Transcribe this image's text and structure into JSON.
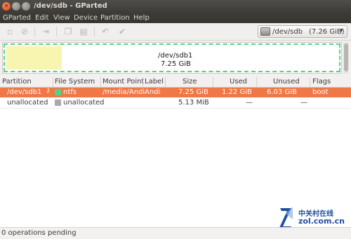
{
  "window": {
    "title": "/dev/sdb - GParted"
  },
  "menubar": {
    "items": [
      "GParted",
      "Edit",
      "View",
      "Device",
      "Partition",
      "Help"
    ]
  },
  "toolbar": {
    "buttons": [
      "new-icon",
      "delete-icon",
      "resize-icon",
      "copy-icon",
      "paste-icon",
      "undo-icon",
      "apply-icon"
    ]
  },
  "device_selector": {
    "device": "/dev/sdb",
    "size": "(7.26 GiB)"
  },
  "disk_map": {
    "partition": "/dev/sdb1",
    "size": "7.25 GiB",
    "used_fraction": 0.168,
    "colors": {
      "used": "#f7f5b0",
      "border": "#57d183"
    }
  },
  "table": {
    "columns": [
      "Partition",
      "File System",
      "Mount Point",
      "Label",
      "Size",
      "Used",
      "Unused",
      "Flags"
    ],
    "rows": [
      {
        "partition": "/dev/sdb1",
        "fs": "ntfs",
        "fs_color": "#57d183",
        "mount": "/media/Andi",
        "label": "Andi",
        "size": "7.25 GiB",
        "used": "1.22 GiB",
        "unused": "6.03 GiB",
        "flags": "boot",
        "selected": true
      },
      {
        "partition": "unallocated",
        "fs": "unallocated",
        "fs_color": "#a9a9a9",
        "mount": "",
        "label": "",
        "size": "5.13 MiB",
        "used": "—",
        "unused": "—",
        "flags": "",
        "selected": false
      }
    ]
  },
  "statusbar": {
    "text": "0 operations pending"
  },
  "watermark": {
    "cn": "中关村在线",
    "en": "zol.com.cn"
  },
  "colors": {
    "selection": "#f07746",
    "titlebar": "#3c3b37"
  }
}
